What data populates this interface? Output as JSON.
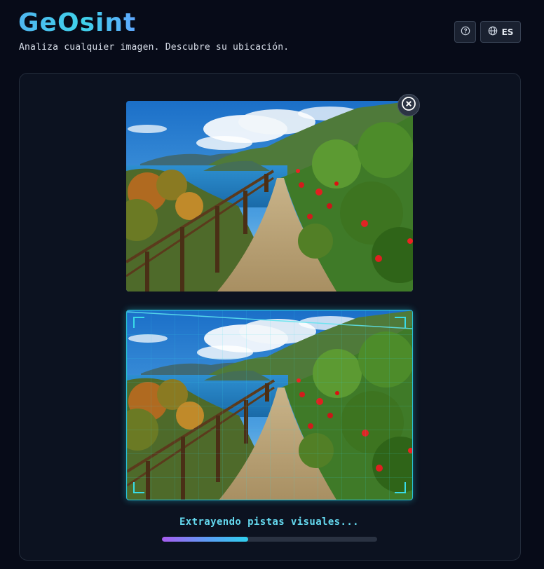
{
  "app": {
    "title": "GeOsint",
    "tagline": "Analiza cualquier imagen. Descubre su ubicación."
  },
  "header": {
    "help_icon": "help-circle-icon",
    "language": {
      "icon": "globe-icon",
      "label": "ES"
    }
  },
  "upload": {
    "image_description": "coastal cliff path with wooden fence, sea and red flowers",
    "remove_icon": "close-circle-icon"
  },
  "analysis": {
    "status": "Extrayendo pistas visuales...",
    "progress": 0.4
  },
  "colors": {
    "background": "#070b18",
    "panel": "#0c1220",
    "accent_cyan": "#39dbe8",
    "accent_purple": "#a85cf0"
  }
}
